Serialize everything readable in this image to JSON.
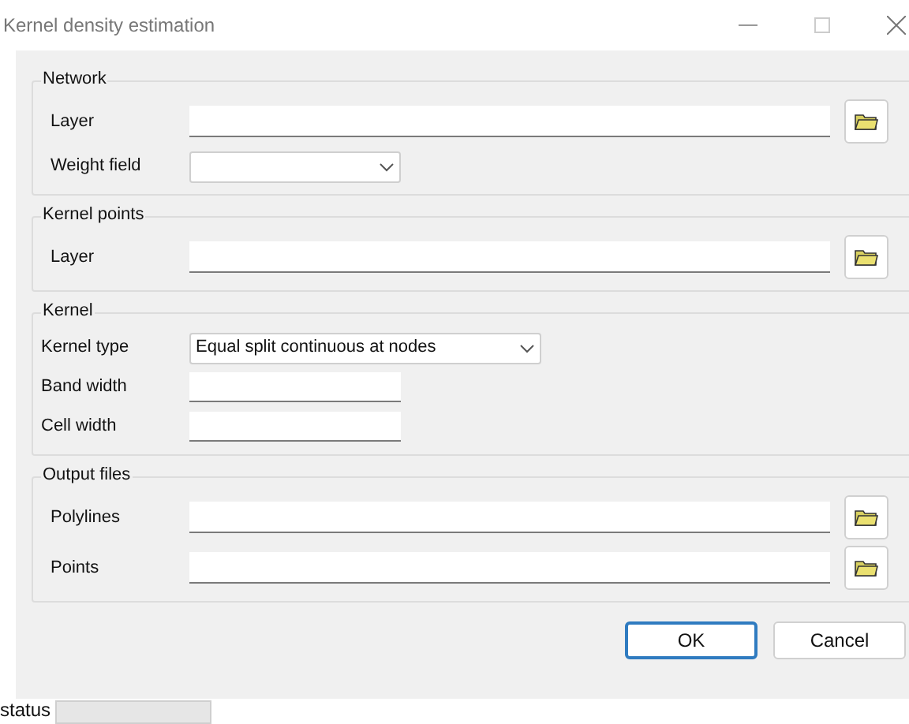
{
  "window": {
    "title": "Kernel density estimation"
  },
  "groups": [
    {
      "title": "Network",
      "fields": [
        {
          "kind": "file",
          "label": "Layer"
        },
        {
          "kind": "combo",
          "label": "Weight field"
        }
      ]
    },
    {
      "title": "Kernel points",
      "fields": [
        {
          "kind": "file",
          "label": "Layer"
        }
      ]
    },
    {
      "title": "Kernel",
      "fields": [
        {
          "kind": "combo",
          "label": "Kernel type",
          "value": "Equal split continuous at nodes",
          "wide": true
        },
        {
          "kind": "text",
          "label": "Band width"
        },
        {
          "kind": "text",
          "label": "Cell width"
        }
      ]
    },
    {
      "title": "Output files",
      "fields": [
        {
          "kind": "file",
          "label": "Polylines"
        },
        {
          "kind": "file",
          "label": "Points"
        }
      ]
    }
  ],
  "buttons": [
    {
      "label": "OK",
      "default": true
    },
    {
      "label": "Cancel",
      "default": false
    }
  ],
  "status_bar": {
    "label": "status"
  }
}
